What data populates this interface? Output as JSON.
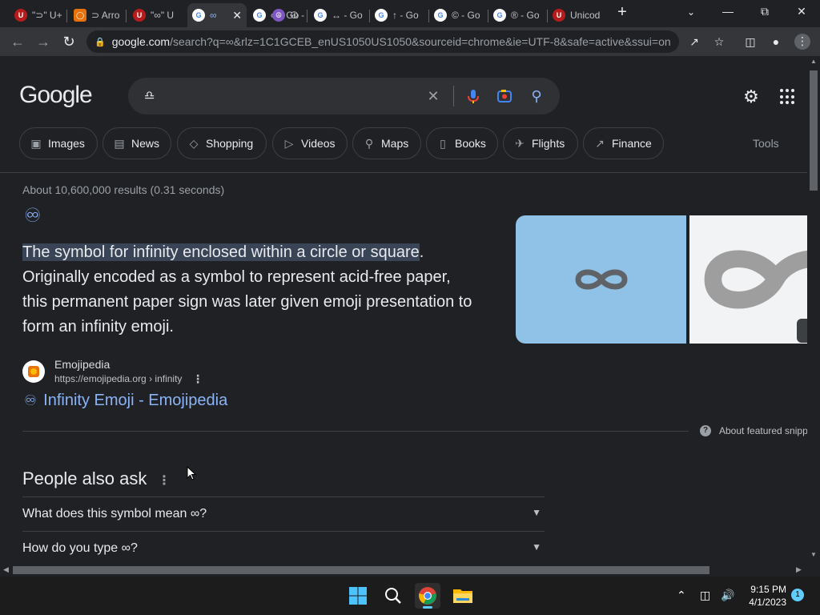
{
  "browser": {
    "tabs": [
      {
        "label": "\"⊃\" U+",
        "favicon": "unicode-site-icon",
        "color": "#b71c1c"
      },
      {
        "label": "⊃ Arro",
        "favicon": "orange-site-icon",
        "color": "#e8710a"
      },
      {
        "label": "\"∞\" U",
        "favicon": "unicode-site-icon",
        "color": "#b71c1c"
      },
      {
        "label": "∞",
        "favicon": "google-icon",
        "color": "#4285f4"
      },
      {
        "label": "∞ - Go",
        "favicon": "google-icon",
        "color": "#4285f4"
      },
      {
        "label": "☮ - G",
        "favicon": "peace-icon",
        "color": "#7e57c2"
      },
      {
        "label": "↔ - Go",
        "favicon": "google-icon",
        "color": "#4285f4"
      },
      {
        "label": "↑ - Go",
        "favicon": "google-icon",
        "color": "#4285f4"
      },
      {
        "label": "© - Go",
        "favicon": "google-icon",
        "color": "#4285f4"
      },
      {
        "label": "® - Go",
        "favicon": "google-icon",
        "color": "#4285f4"
      },
      {
        "label": "Unicod",
        "favicon": "unicode-site-icon",
        "color": "#b71c1c"
      }
    ],
    "url_host": "google.com",
    "url_rest": "/search?q=∞&rlz=1C1GCEB_enUS1050US1050&sourceid=chrome&ie=UTF-8&safe=active&ssui=on"
  },
  "search": {
    "logo": "Google",
    "query": "♎",
    "chips": [
      {
        "label": "Images",
        "icon": "image-icon",
        "glyph": "▣"
      },
      {
        "label": "News",
        "icon": "news-icon",
        "glyph": "▤"
      },
      {
        "label": "Shopping",
        "icon": "tag-icon",
        "glyph": "◇"
      },
      {
        "label": "Videos",
        "icon": "play-icon",
        "glyph": "▷"
      },
      {
        "label": "Maps",
        "icon": "map-pin-icon",
        "glyph": "⚲"
      },
      {
        "label": "Books",
        "icon": "book-icon",
        "glyph": "▯"
      },
      {
        "label": "Flights",
        "icon": "plane-icon",
        "glyph": "✈"
      },
      {
        "label": "Finance",
        "icon": "finance-icon",
        "glyph": "↗"
      }
    ],
    "tools": "Tools",
    "stats": "About 10,600,000 results (0.31 seconds)"
  },
  "featured": {
    "symbol": "♾",
    "snippet_highlight": "The symbol for infinity enclosed within a circle or square",
    "snippet_rest": ". Originally encoded as a symbol to represent acid-free paper, this permanent paper sign was later given emoji presentation to form an infinity emoji.",
    "source_name": "Emojipedia",
    "source_url": "https://emojipedia.org › infinity",
    "result_title": "Infinity Emoji - Emojipedia",
    "about": "About featured snipp"
  },
  "paa": {
    "heading": "People also ask",
    "questions": [
      "What does this symbol mean ∞?",
      "How do you type ∞?"
    ]
  },
  "taskbar": {
    "time": "9:15 PM",
    "date": "4/1/2023",
    "notifications": "1"
  },
  "colors": {
    "link": "#8ab4f8",
    "thumb_bg": "#8fc2e6",
    "accent": "#60cdff"
  }
}
